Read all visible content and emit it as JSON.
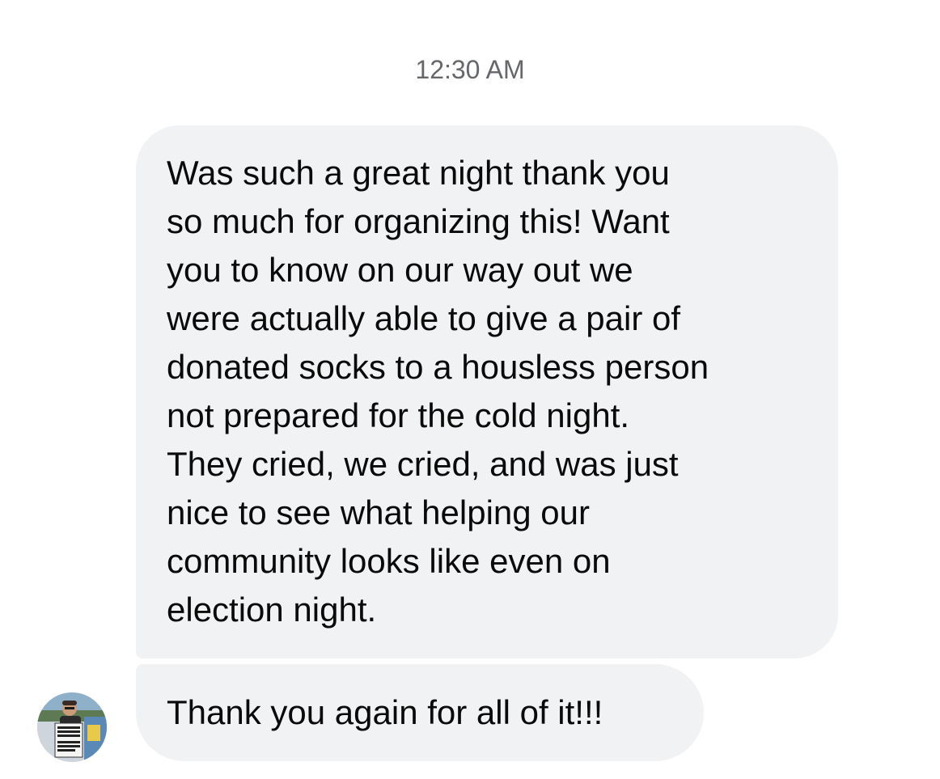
{
  "timestamp": "12:30 AM",
  "messages": [
    {
      "lines": [
        "Was such a great night thank you",
        "so much for organizing this! Want",
        "you to know on our way out we",
        "were actually able to give a pair of",
        "donated socks to a housless person",
        "not prepared for the cold night.",
        "They cried, we cried, and was just",
        "nice to see what helping our",
        "community looks like even on",
        "election night."
      ]
    },
    {
      "text": "Thank you again for all of it!!!"
    }
  ],
  "avatar": {
    "icon": "profile-photo",
    "sign_text": "FIGHT BIGOTRY & DIVISION NOT TRANS PEOPLE!"
  }
}
